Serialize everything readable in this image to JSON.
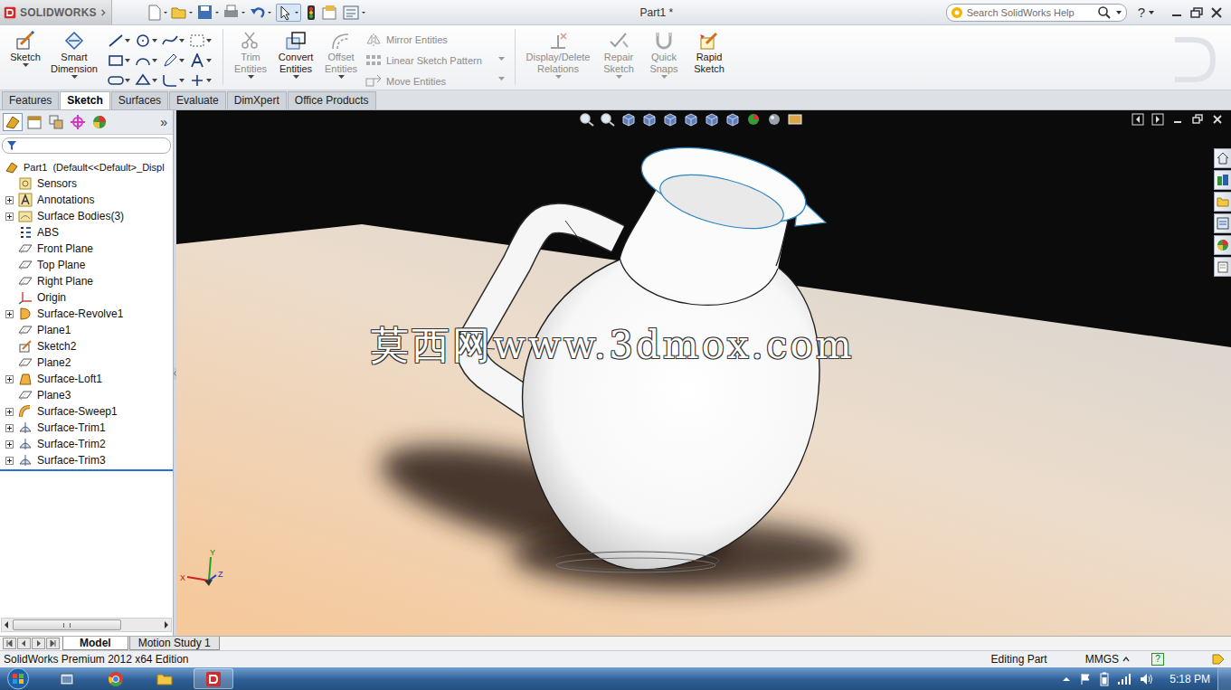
{
  "titlebar": {
    "logo": "SOLIDWORKS",
    "title": "Part1 *",
    "search_placeholder": "Search SolidWorks Help",
    "help": "?"
  },
  "ribbon": {
    "tools": [
      {
        "label": "Sketch",
        "disabled": false,
        "kind": "sketch"
      },
      {
        "label": "Smart Dimension",
        "disabled": false,
        "kind": "dimension"
      }
    ],
    "edit_tools": [
      {
        "label": "Trim Entities",
        "disabled": true,
        "kind": "trim"
      },
      {
        "label": "Convert Entities",
        "disabled": false,
        "kind": "convert"
      },
      {
        "label": "Offset Entities",
        "disabled": true,
        "kind": "offset"
      }
    ],
    "small_tools": [
      {
        "label": "Mirror Entities",
        "disabled": true,
        "kind": "mirror"
      },
      {
        "label": "Linear Sketch Pattern",
        "disabled": true,
        "kind": "pattern"
      },
      {
        "label": "Move Entities",
        "disabled": true,
        "kind": "move"
      }
    ],
    "more_tools": [
      {
        "label": "Display/Delete Relations",
        "disabled": true,
        "kind": "relations"
      },
      {
        "label": "Repair Sketch",
        "disabled": true,
        "kind": "repair"
      },
      {
        "label": "Quick Snaps",
        "disabled": true,
        "kind": "snaps"
      },
      {
        "label": "Rapid Sketch",
        "disabled": false,
        "kind": "rapid"
      }
    ]
  },
  "tabs": [
    {
      "label": "Features",
      "selected": false
    },
    {
      "label": "Sketch",
      "selected": true
    },
    {
      "label": "Surfaces",
      "selected": false
    },
    {
      "label": "Evaluate",
      "selected": false
    },
    {
      "label": "DimXpert",
      "selected": false
    },
    {
      "label": "Office Products",
      "selected": false
    }
  ],
  "feature_tree": {
    "expand": "»",
    "root": {
      "label": "Part1  (Default<<Default>_Displ",
      "kind": "part"
    },
    "items": [
      {
        "label": "Sensors",
        "kind": "sensor",
        "expandable": false
      },
      {
        "label": "Annotations",
        "kind": "annotation",
        "expandable": true
      },
      {
        "label": "Surface Bodies(3)",
        "kind": "bodies",
        "expandable": true
      },
      {
        "label": "ABS",
        "kind": "material",
        "expandable": false
      },
      {
        "label": "Front Plane",
        "kind": "plane",
        "expandable": false
      },
      {
        "label": "Top Plane",
        "kind": "plane",
        "expandable": false
      },
      {
        "label": "Right Plane",
        "kind": "plane",
        "expandable": false
      },
      {
        "label": "Origin",
        "kind": "origin",
        "expandable": false
      },
      {
        "label": "Surface-Revolve1",
        "kind": "revolve",
        "expandable": true
      },
      {
        "label": "Plane1",
        "kind": "plane",
        "expandable": false
      },
      {
        "label": "Sketch2",
        "kind": "sketch",
        "expandable": false
      },
      {
        "label": "Plane2",
        "kind": "plane",
        "expandable": false
      },
      {
        "label": "Surface-Loft1",
        "kind": "loft",
        "expandable": true
      },
      {
        "label": "Plane3",
        "kind": "plane",
        "expandable": false
      },
      {
        "label": "Surface-Sweep1",
        "kind": "sweep",
        "expandable": true
      },
      {
        "label": "Surface-Trim1",
        "kind": "trim",
        "expandable": true
      },
      {
        "label": "Surface-Trim2",
        "kind": "trim",
        "expandable": true
      },
      {
        "label": "Surface-Trim3",
        "kind": "trim",
        "expandable": true
      }
    ]
  },
  "viewport": {
    "watermark": "莫西网www.3dmox.com",
    "axes": [
      "X",
      "Y",
      "Z"
    ]
  },
  "bottom_tabs": [
    {
      "label": "Model",
      "selected": true
    },
    {
      "label": "Motion Study 1",
      "selected": false
    }
  ],
  "status_bar": {
    "product": "SolidWorks Premium 2012 x64 Edition",
    "mode": "Editing Part",
    "units": "MMGS",
    "help": "?"
  },
  "taskbar": {
    "time": "5:18 PM"
  }
}
